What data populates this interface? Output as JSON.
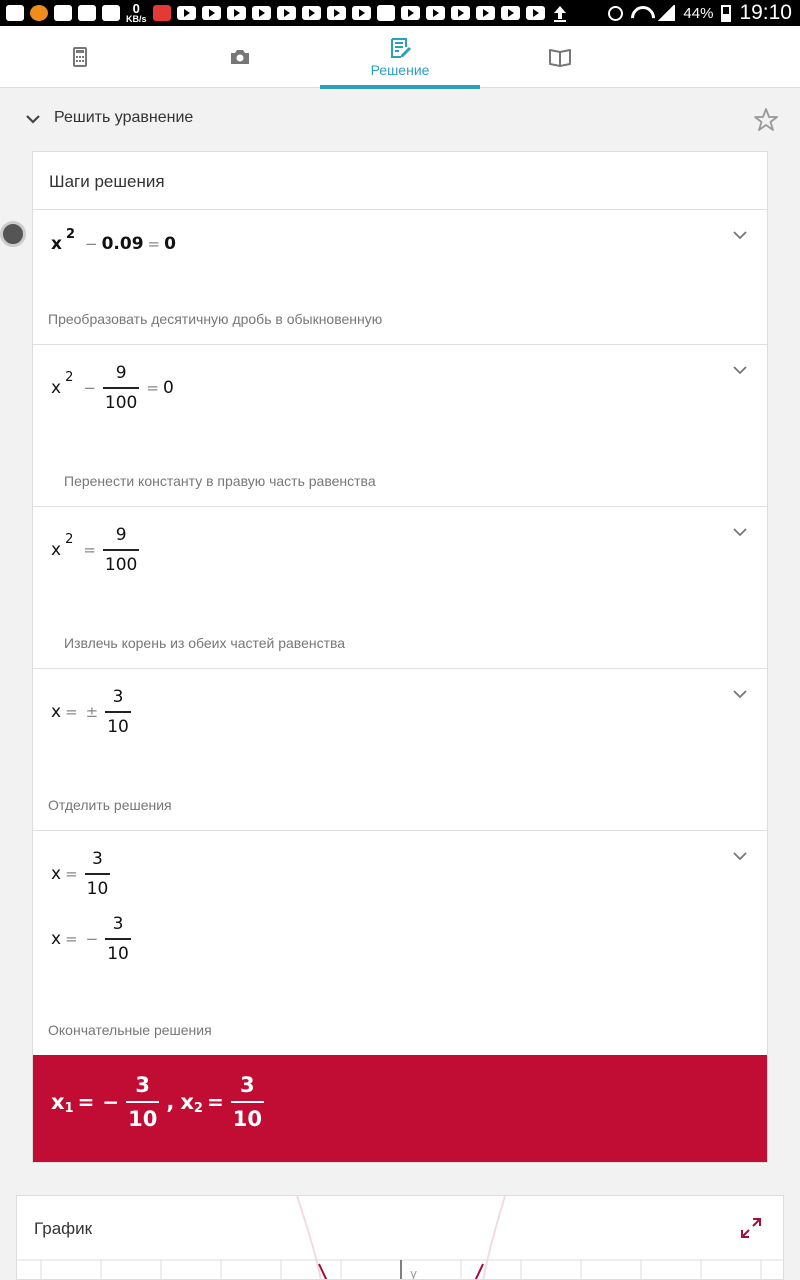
{
  "status_bar": {
    "speed_value": "0",
    "speed_unit": "KB/s",
    "battery": "44%",
    "time": "19:10"
  },
  "tabs": [
    {
      "icon": "calculator-icon",
      "label": ""
    },
    {
      "icon": "camera-icon",
      "label": ""
    },
    {
      "icon": "solution-icon",
      "label": "Решение",
      "active": true
    },
    {
      "icon": "book-icon",
      "label": ""
    }
  ],
  "header": {
    "title": "Решить уравнение"
  },
  "card": {
    "title": "Шаги решения",
    "steps": [
      {
        "desc": "Преобразовать десятичную дробь в обыкновенную"
      },
      {
        "desc": "Перенести константу в правую часть равенства"
      },
      {
        "desc": "Извлечь корень из обеих частей равенства"
      },
      {
        "desc": "Отделить решения"
      },
      {
        "desc": "Окончательные решения"
      }
    ],
    "math": {
      "x": "x",
      "sq": "2",
      "minus": "−",
      "eq": "=",
      "pm": "±",
      "c009": "0.09",
      "zero": "0",
      "nine": "9",
      "hundred": "100",
      "three": "3",
      "ten": "10",
      "comma": ",",
      "sub1": "1",
      "sub2": "2"
    }
  },
  "graph": {
    "title": "График",
    "axis_label": "y"
  },
  "colors": {
    "accent": "#2a9fbf",
    "result_bg": "#c10c34",
    "curve": "#a0103a"
  }
}
